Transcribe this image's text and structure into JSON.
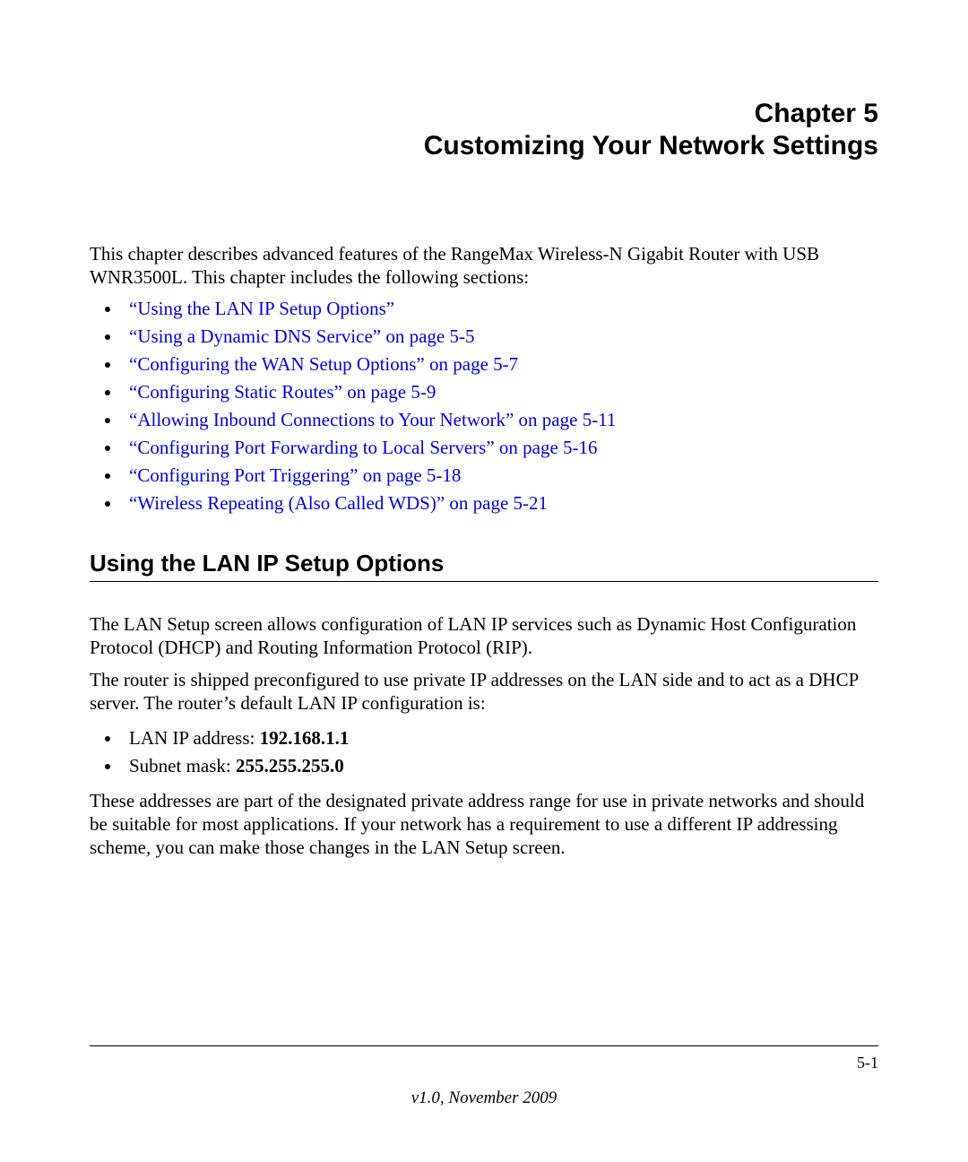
{
  "chapter": {
    "number": "Chapter 5",
    "title": "Customizing Your Network Settings"
  },
  "intro": "This chapter describes advanced features of the RangeMax Wireless-N Gigabit Router with USB WNR3500L. This chapter includes the following sections:",
  "toc": [
    "“Using the LAN IP Setup Options”",
    "“Using a Dynamic DNS Service” on page 5-5",
    "“Configuring the WAN Setup Options” on page 5-7",
    "“Configuring Static Routes” on page 5-9",
    "“Allowing Inbound Connections to Your Network” on page 5-11",
    "“Configuring Port Forwarding to Local Servers” on page 5-16",
    "“Configuring Port Triggering” on page 5-18",
    "“Wireless Repeating (Also Called WDS)” on page 5-21"
  ],
  "section": {
    "heading": "Using the LAN IP Setup Options",
    "p1": "The LAN Setup screen allows configuration of LAN IP services such as Dynamic Host Configuration Protocol (DHCP) and Routing Information Protocol (RIP).",
    "p2": "The router is shipped preconfigured to use private IP addresses on the LAN side and to act as a DHCP server. The router’s default LAN IP configuration is:",
    "config": [
      {
        "label": "LAN IP address: ",
        "value": "192.168.1.1"
      },
      {
        "label": "Subnet mask: ",
        "value": "255.255.255.0"
      }
    ],
    "p3": "These addresses are part of the designated private address range for use in private networks and should be suitable for most applications. If your network has a requirement to use a different IP addressing scheme, you can make those changes in the LAN Setup screen."
  },
  "footer": {
    "page": "5-1",
    "version": "v1.0, November 2009"
  }
}
